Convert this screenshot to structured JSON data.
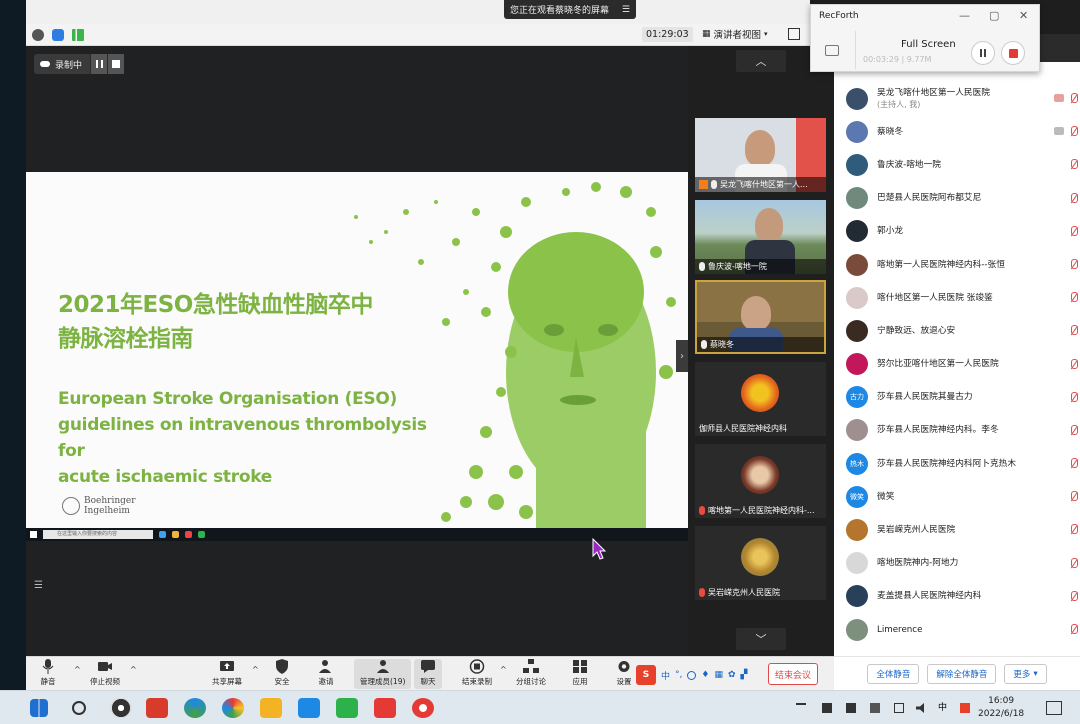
{
  "share_banner": {
    "text": "您正在观看蔡晓冬的屏幕",
    "menu_icon": "menu-icon"
  },
  "meeting_top": {
    "timer": "01:29:03",
    "view_label": "演讲者视图"
  },
  "recording": {
    "label": "录制中"
  },
  "slide": {
    "title_line1": "2021年ESO急性缺血性脑卒中",
    "title_line2": "静脉溶栓指南",
    "subtitle_line1": "European Stroke Organisation (ESO)",
    "subtitle_line2": "guidelines on intravenous thrombolysis for",
    "subtitle_line3": "acute ischaemic stroke",
    "logo_line1": "Boehringer",
    "logo_line2": "Ingelheim",
    "accent": "#7cb342",
    "mini_search": "在这里输入你要搜索的内容"
  },
  "gallery": [
    {
      "name": "吴龙飞喀什地区第一人...",
      "muted": false
    },
    {
      "name": "鲁庆波-喀地一院",
      "muted": false
    },
    {
      "name": "蔡晓冬",
      "muted": false
    },
    {
      "name": "伽师县人民医院神经内科",
      "muted": false
    },
    {
      "name": "喀地第一人民医院神经内科-...",
      "muted": true
    },
    {
      "name": "吴岩嵘克州人民医院",
      "muted": true
    }
  ],
  "participants": [
    {
      "name": "吴龙飞喀什地区第一人民医院",
      "sub": "(主持人, 我)",
      "avatar_text": "",
      "avatar_color": "#3a4f6a"
    },
    {
      "name": "蔡晓冬",
      "sub": "",
      "avatar_text": "",
      "avatar_color": "#5b79b0"
    },
    {
      "name": "鲁庆波-喀地一院",
      "sub": "",
      "avatar_text": "",
      "avatar_color": "#2f5c7a"
    },
    {
      "name": "巴楚县人民医院阿布都艾尼",
      "sub": "",
      "avatar_text": "",
      "avatar_color": "#6f8a7c"
    },
    {
      "name": "郭小龙",
      "sub": "",
      "avatar_text": "",
      "avatar_color": "#222a33"
    },
    {
      "name": "喀地第一人民医院神经内科--张恒",
      "sub": "",
      "avatar_text": "",
      "avatar_color": "#7a4b3a"
    },
    {
      "name": "喀什地区第一人民医院 张竣鉴",
      "sub": "",
      "avatar_text": "",
      "avatar_color": "#d9c9c9"
    },
    {
      "name": "宁静致远、放退心安",
      "sub": "",
      "avatar_text": "",
      "avatar_color": "#3b2a22"
    },
    {
      "name": "努尔比亚喀什地区第一人民医院",
      "sub": "",
      "avatar_text": "",
      "avatar_color": "#c2185b"
    },
    {
      "name": "莎车县人民医院其曼古力",
      "sub": "",
      "avatar_text": "古力",
      "avatar_color": "#1e88e5"
    },
    {
      "name": "莎车县人民医院神经内科。李冬",
      "sub": "",
      "avatar_text": "",
      "avatar_color": "#a08f8f"
    },
    {
      "name": "莎车县人民医院神经内科阿卜克热木",
      "sub": "",
      "avatar_text": "热木",
      "avatar_color": "#1e88e5"
    },
    {
      "name": "微笑",
      "sub": "",
      "avatar_text": "微笑",
      "avatar_color": "#1e88e5"
    },
    {
      "name": "吴岩嵘克州人民医院",
      "sub": "",
      "avatar_text": "",
      "avatar_color": "#b3762c"
    },
    {
      "name": "喀地医院神内-阿地力",
      "sub": "",
      "avatar_text": "",
      "avatar_color": "#d8d8d8"
    },
    {
      "name": "麦盖提县人民医院神经内科",
      "sub": "",
      "avatar_text": "",
      "avatar_color": "#28405a"
    },
    {
      "name": "Limerence",
      "sub": "",
      "avatar_text": "",
      "avatar_color": "#7d8f7d"
    }
  ],
  "participants_footer": {
    "mute_all": "全体静音",
    "unmute_all": "解除全体静音",
    "more": "更多"
  },
  "recforth": {
    "title": "RecForth",
    "mode": "Full Screen",
    "stats": "00:03:29 | 9.77M"
  },
  "toolbar": {
    "mute": "静音",
    "stop_video": "停止视频",
    "share_screen": "共享屏幕",
    "security": "安全",
    "invite": "邀请",
    "manage_members": "管理成员(19)",
    "chat": "聊天",
    "end_recording": "结束录制",
    "breakout": "分组讨论",
    "apps": "应用",
    "settings": "设置",
    "end_meeting": "结束会议",
    "ime_label": "中"
  },
  "system": {
    "time": "16:09",
    "date": "2022/6/18"
  }
}
